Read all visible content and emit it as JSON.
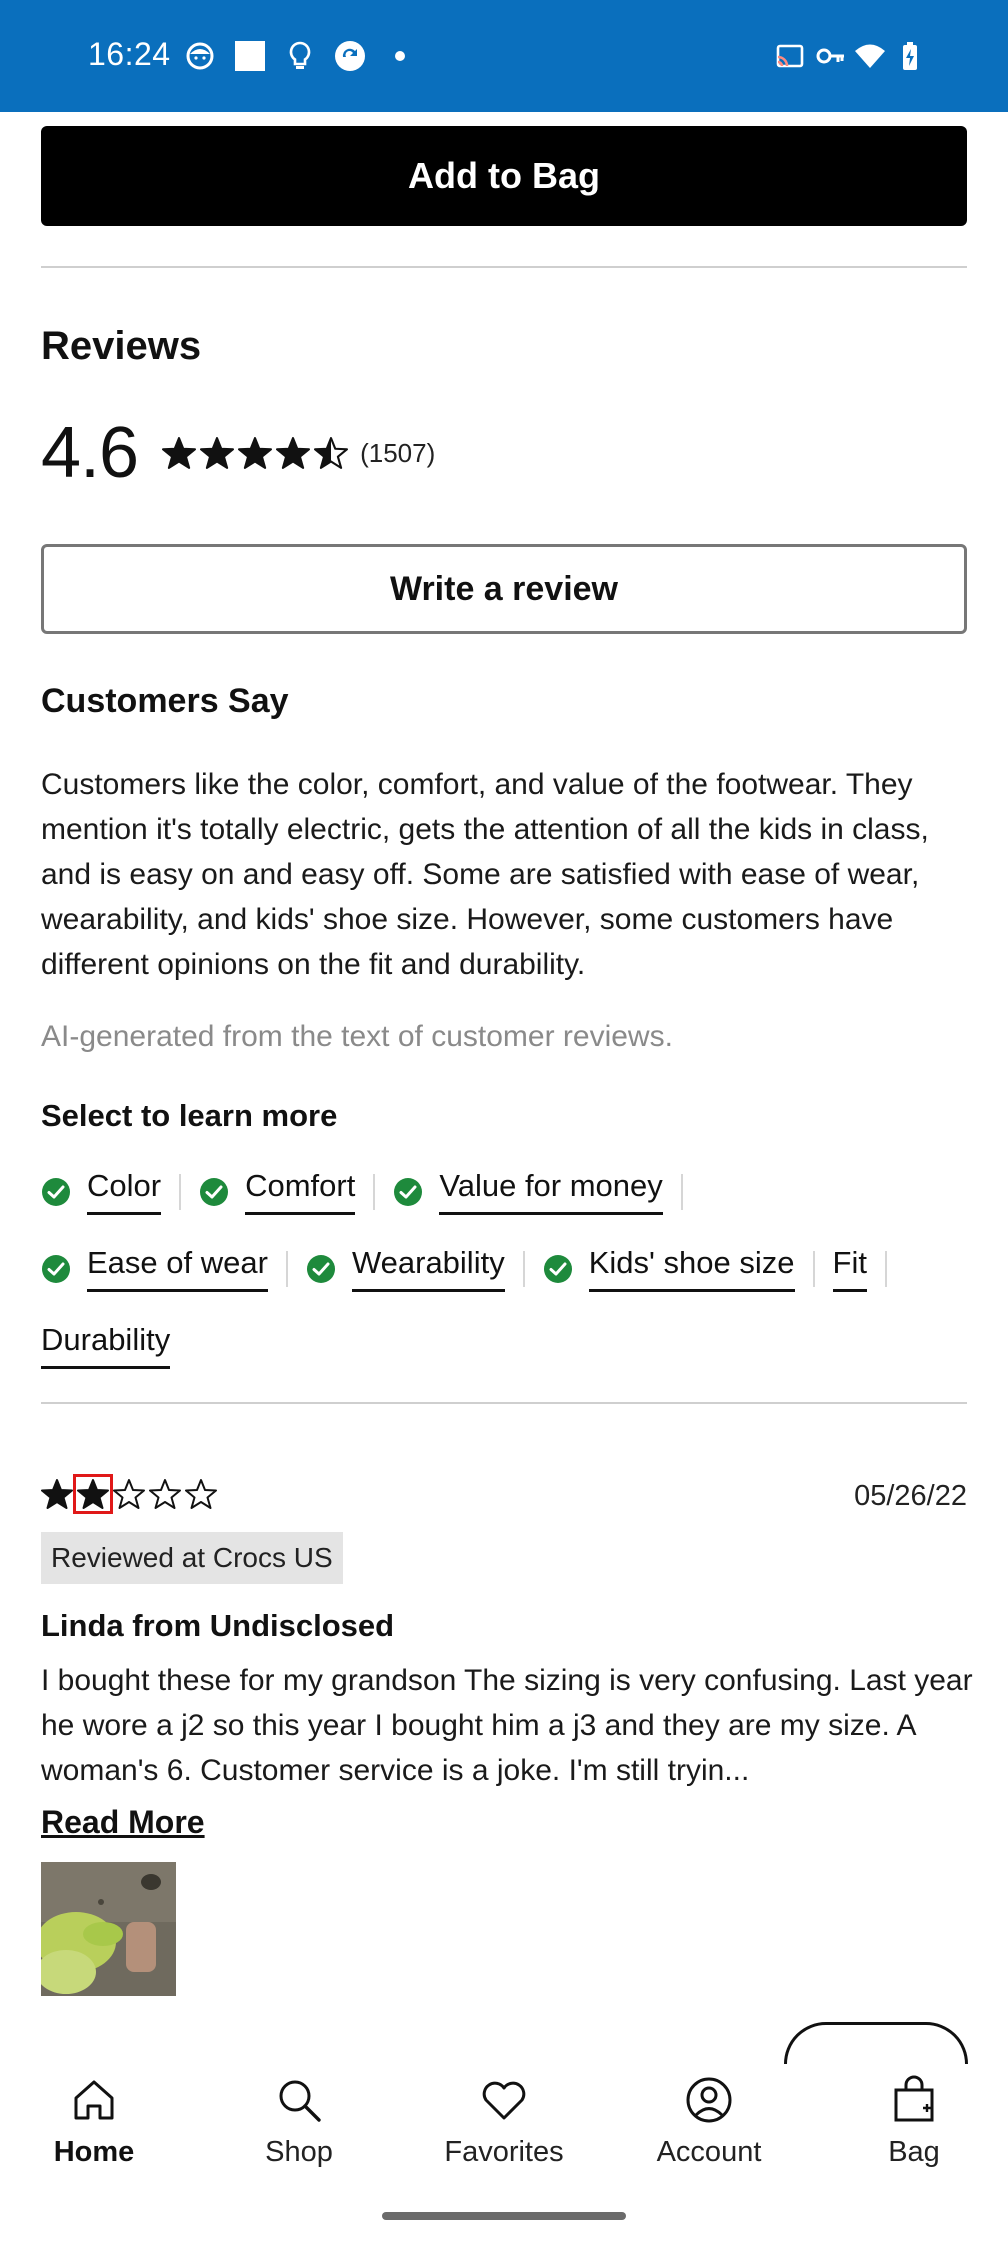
{
  "status_bar": {
    "time": "16:24",
    "background": "#0a6fbd",
    "left_icons": [
      "face-icon",
      "square-icon",
      "lightbulb-icon",
      "sync-icon",
      "dot-icon"
    ],
    "right_icons": [
      "cast-icon",
      "vpn-key-icon",
      "wifi-icon",
      "battery-charging-icon"
    ]
  },
  "product": {
    "add_to_bag_label": "Add to Bag"
  },
  "reviews": {
    "heading": "Reviews",
    "average_rating": "4.6",
    "average_rating_value": 4.6,
    "review_count": "(1507)",
    "write_review_label": "Write a review"
  },
  "customers_say": {
    "heading": "Customers Say",
    "summary": "Customers like the color, comfort, and value of the footwear. They mention it's totally electric, gets the attention of all the kids in class, and is easy on and easy off. Some are satisfied with ease of wear, wearability, and kids' shoe size. However, some customers have different opinions on the fit and durability.",
    "ai_note": "AI-generated from the text of customer reviews.",
    "learn_more_label": "Select to learn more",
    "topics_row1": [
      {
        "label": "Color",
        "positive": true
      },
      {
        "label": "Comfort",
        "positive": true
      },
      {
        "label": "Value for money",
        "positive": true
      }
    ],
    "topics_row2": [
      {
        "label": "Ease of wear",
        "positive": true
      },
      {
        "label": "Wearability",
        "positive": true
      },
      {
        "label": "Kids' shoe size",
        "positive": true
      },
      {
        "label": "Fit",
        "positive": false
      }
    ],
    "topics_row3": [
      {
        "label": "Durability",
        "positive": false
      }
    ],
    "check_color": "#1e8a3c"
  },
  "review": {
    "rating": 2,
    "rating_max": 5,
    "date": "05/26/22",
    "source": "Reviewed at Crocs US",
    "author": "Linda from Undisclosed",
    "text": "I bought these for my grandson   The sizing is very confusing. Last year he wore a j2 so this year I bought him a j3 and they are my size. A woman's 6. Customer service is a joke.  I'm still tryin...",
    "read_more_label": "Read More"
  },
  "bottom_nav": {
    "items": [
      {
        "label": "Home",
        "icon": "home-icon",
        "active": true
      },
      {
        "label": "Shop",
        "icon": "search-icon",
        "active": false
      },
      {
        "label": "Favorites",
        "icon": "heart-icon",
        "active": false
      },
      {
        "label": "Account",
        "icon": "account-icon",
        "active": false
      },
      {
        "label": "Bag",
        "icon": "bag-icon",
        "active": false
      }
    ]
  }
}
